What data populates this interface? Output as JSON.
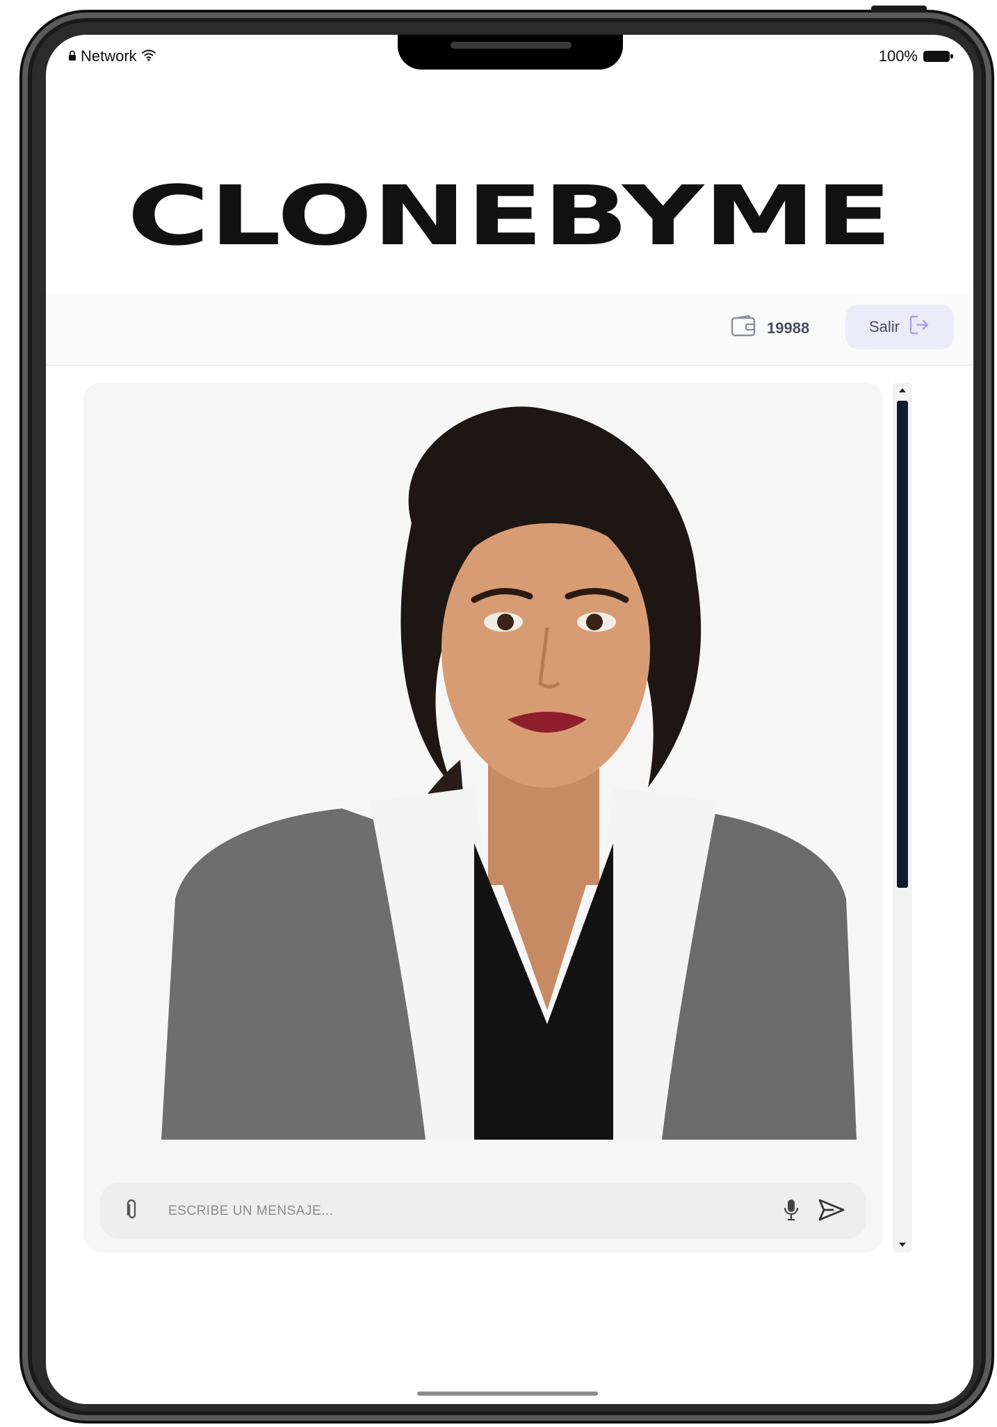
{
  "status_bar": {
    "network_label": "Network",
    "battery_label": "100%"
  },
  "brand": {
    "logo_text": "CLONEBYME",
    "logo_color": "#111111"
  },
  "header": {
    "balance_value": "19988",
    "logout_label": "Salir"
  },
  "chat": {
    "message_placeholder": "ESCRIBE UN MENSAJE..."
  },
  "colors": {
    "accent_pill": "#ecebfa",
    "scroll_thumb": "#0e1a2e",
    "panel_bg": "#f6f6f6"
  },
  "scroll": {
    "position_fraction": 0.0,
    "visible_fraction": 0.57
  },
  "icons": [
    "lock-icon",
    "wifi-icon",
    "battery-icon",
    "wallet-icon",
    "logout-icon",
    "attach-icon",
    "microphone-icon",
    "send-icon"
  ]
}
